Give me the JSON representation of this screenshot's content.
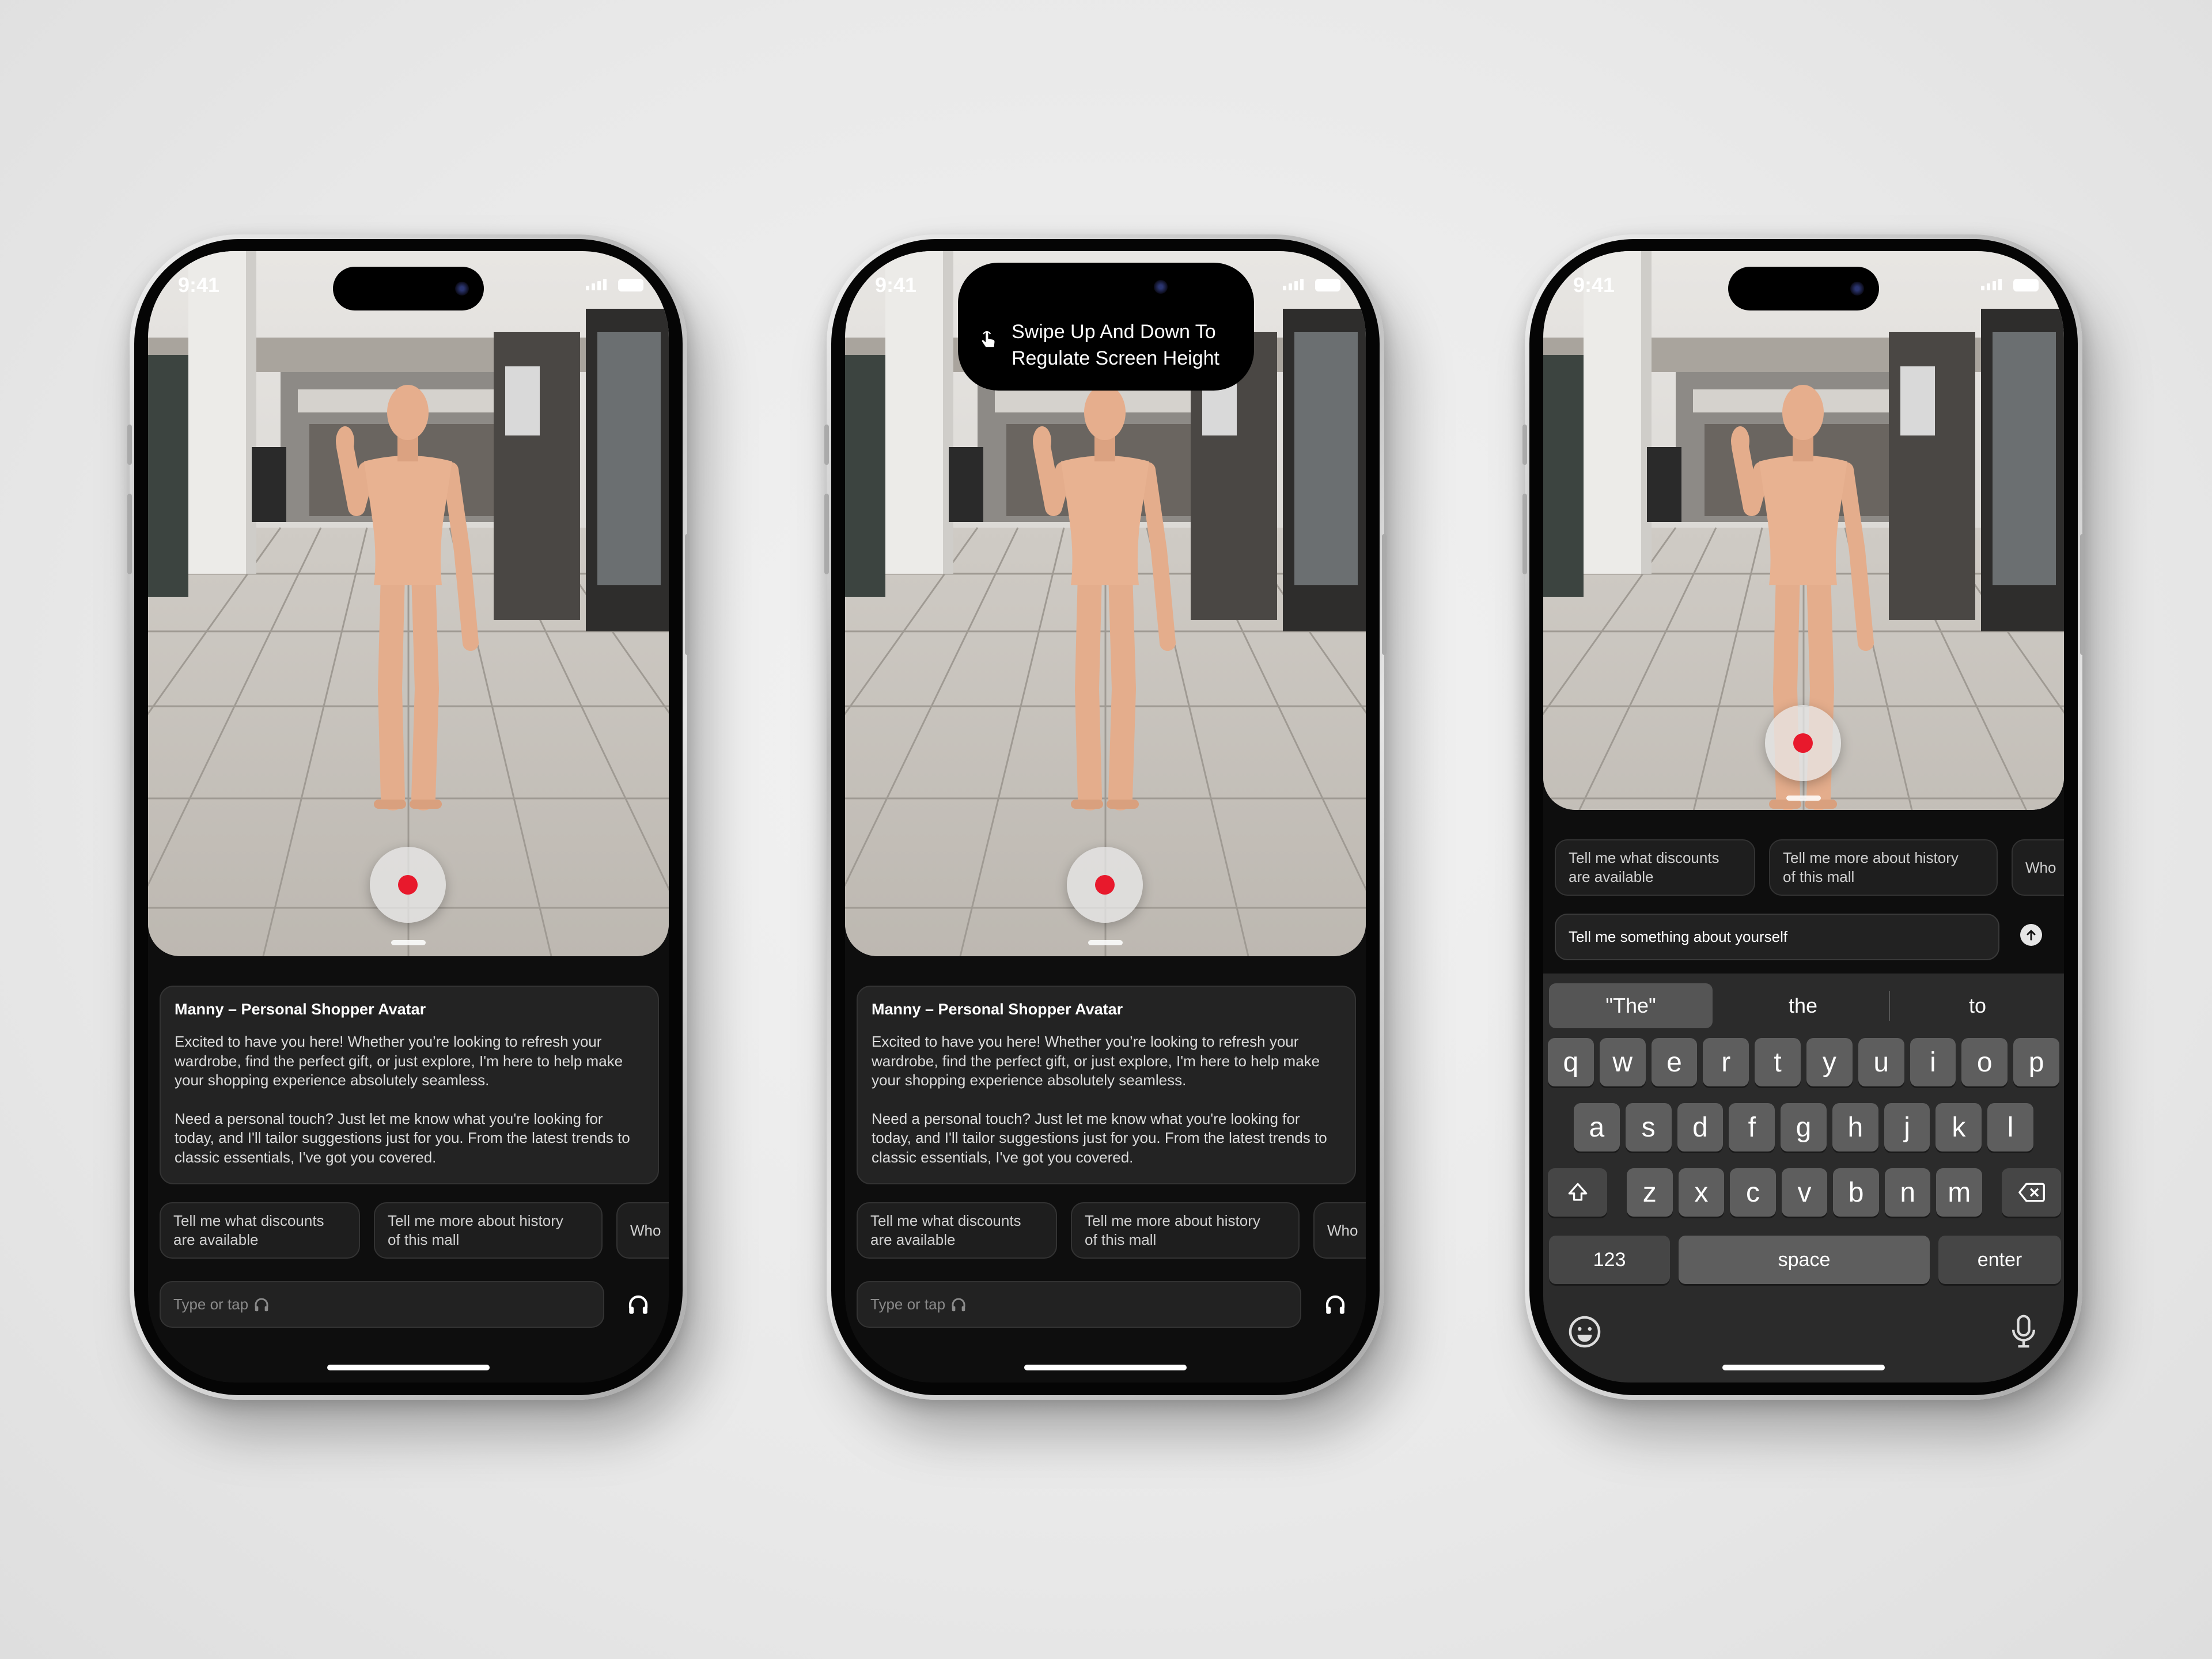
{
  "status": {
    "time": "9:41"
  },
  "tooltip": {
    "icon": "hand-tap-icon",
    "line1": "Swipe Up And Down To",
    "line2": "Regulate Screen Height"
  },
  "card": {
    "title": "Manny – Personal Shopper Avatar",
    "paragraphs": [
      "Excited to have you here! Whether you’re looking to refresh your wardrobe, find the perfect gift, or just explore, I'm here to help make your shopping experience absolutely seamless.",
      "Need a personal touch? Just let me know what you're looking for today, and I'll tailor suggestions just for you. From the latest trends to classic essentials, I've got you covered."
    ]
  },
  "chips": [
    "Tell me what discounts\nare available",
    "Tell me more about history\nof this mall",
    "Who"
  ],
  "input": {
    "placeholder": "Type or tap",
    "value": "Tell me something about yourself",
    "mic_icon": "headphones-icon",
    "send_icon": "send-arrow-up-icon"
  },
  "keyboard": {
    "suggestions": [
      "\"The\"",
      "the",
      "to"
    ],
    "rows": [
      [
        "q",
        "w",
        "e",
        "r",
        "t",
        "y",
        "u",
        "i",
        "o",
        "p"
      ],
      [
        "a",
        "s",
        "d",
        "f",
        "g",
        "h",
        "j",
        "k",
        "l"
      ],
      [
        "z",
        "x",
        "c",
        "v",
        "b",
        "n",
        "m"
      ]
    ],
    "numbers": "123",
    "space": "space",
    "enter": "enter",
    "icons": [
      "shift-icon",
      "backspace-icon",
      "emoji-icon",
      "microphone-icon"
    ]
  },
  "colors": {
    "record": "#e8192c",
    "screen_bg": "#0e0e0e",
    "card_bg": "#232323",
    "keyboard_bg": "#2b2b2b",
    "key": "#5e5e5e"
  }
}
